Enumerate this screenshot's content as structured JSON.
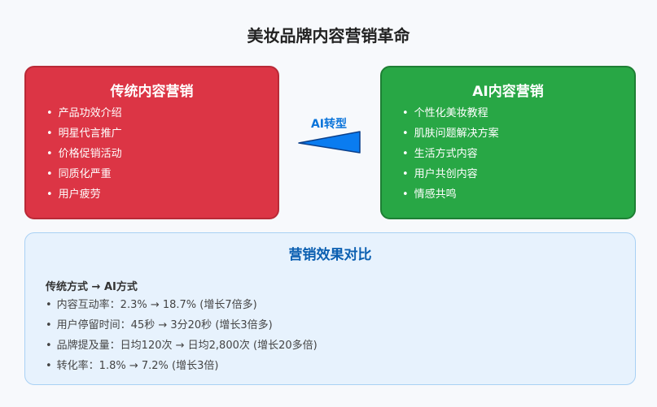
{
  "title": "美妆品牌内容营销革命",
  "traditional": {
    "heading": "传统内容营销",
    "items": [
      "产品功效介绍",
      "明星代言推广",
      "价格促销活动",
      "同质化严重",
      "用户疲劳"
    ],
    "color": "#dc3545"
  },
  "transition": {
    "label": "AI转型",
    "color": "#0a74da"
  },
  "ai": {
    "heading": "AI内容营销",
    "items": [
      "个性化美妆教程",
      "肌肤问题解决方案",
      "生活方式内容",
      "用户共创内容",
      "情感共鸣"
    ],
    "color": "#28a745"
  },
  "comparison": {
    "heading": "营销效果对比",
    "subheading": "传统方式 → AI方式",
    "items": [
      "内容互动率：2.3% → 18.7% (增长7倍多)",
      "用户停留时间：45秒 → 3分20秒 (增长3倍多)",
      "品牌提及量：日均120次 → 日均2,800次 (增长20多倍)",
      "转化率：1.8% → 7.2% (增长3倍)"
    ]
  }
}
